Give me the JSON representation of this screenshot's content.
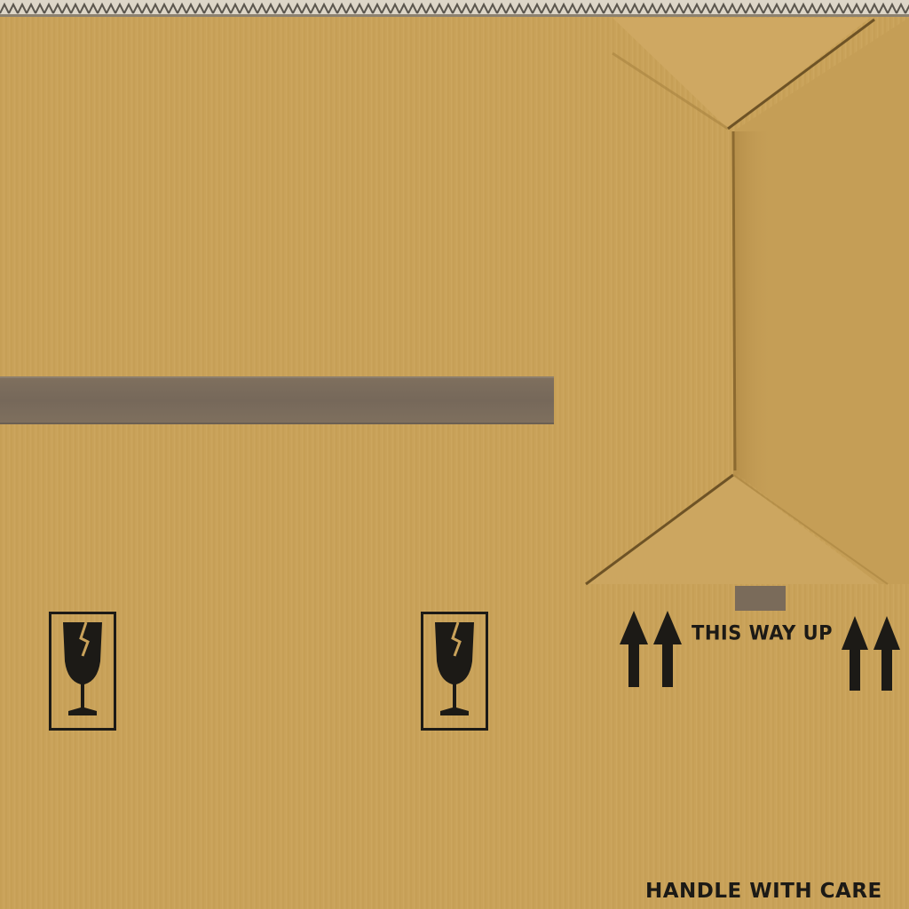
{
  "colors": {
    "cardboard": "#c9a25a",
    "cardboard_light": "#d4ad66",
    "cardboard_shadow": "#a07a3c",
    "tape": "#7a6b5a",
    "ink": "#1c1a16",
    "edge_top": "#6f6a62"
  },
  "markings": {
    "this_way_up": "THIS WAY UP",
    "handle_with_care": "HANDLE WITH CARE"
  },
  "icons": [
    {
      "name": "fragile-glass-icon"
    },
    {
      "name": "fragile-glass-icon"
    },
    {
      "name": "up-arrows-icon"
    },
    {
      "name": "up-arrows-icon"
    }
  ]
}
